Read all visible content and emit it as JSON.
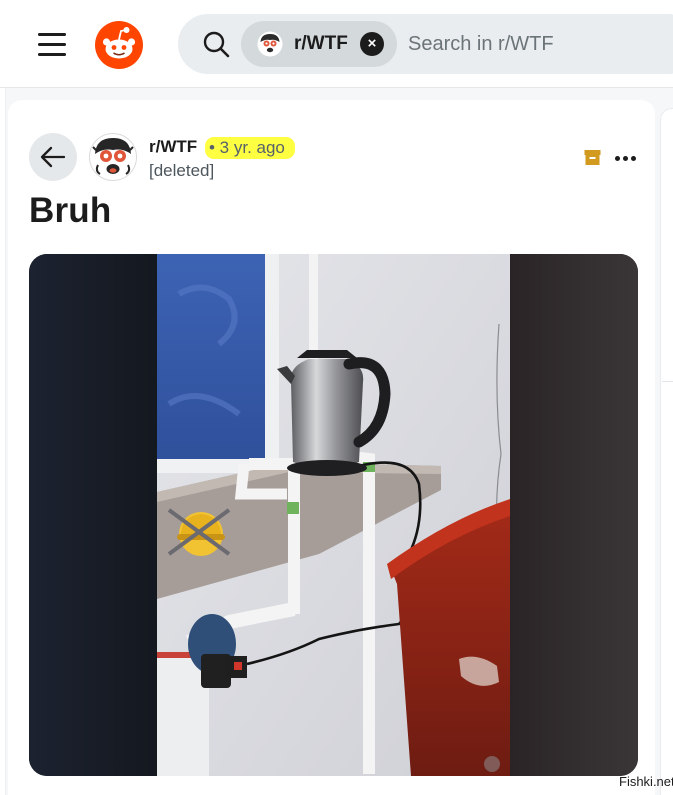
{
  "header": {
    "logo_icon": "reddit-logo-icon",
    "menu_icon": "hamburger-menu-icon",
    "search": {
      "icon": "search-icon",
      "chip_label": "r/WTF",
      "chip_close": "×",
      "placeholder": "Search in r/WTF"
    }
  },
  "post": {
    "subreddit": "r/WTF",
    "age": "• 3 yr. ago",
    "author": "[deleted]",
    "title": "Bruh",
    "archive_icon": "archive-icon",
    "more_icon": "more-options-icon",
    "back_icon": "back-arrow-icon"
  },
  "colors": {
    "highlight": "#ffff42",
    "reddit_orange": "#ff4500",
    "archive_gold": "#d29a1f"
  },
  "watermark": "Fishki.net"
}
